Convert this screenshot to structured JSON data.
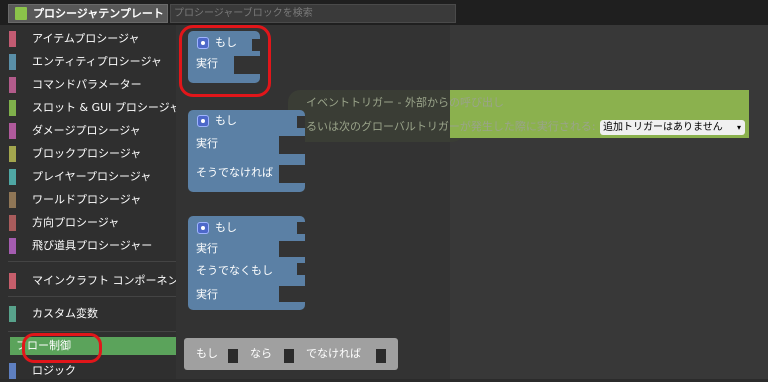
{
  "topbar": {
    "tab_label": "プロシージャテンプレート",
    "search_placeholder": "プロシージャーブロックを検索"
  },
  "sidebar": {
    "categories": [
      {
        "label": "アイテムプロシージャ",
        "color": "#c25b72"
      },
      {
        "label": "エンティティプロシージャ",
        "color": "#5a8fa8"
      },
      {
        "label": "コマンドパラメーター",
        "color": "#b25b8b"
      },
      {
        "label": "スロット & GUI プロシージャ",
        "color": "#7fb04b"
      },
      {
        "label": "ダメージプロシージャ",
        "color": "#b05a9c"
      },
      {
        "label": "ブロックプロシージャ",
        "color": "#a3a64e"
      },
      {
        "label": "プレイヤープロシージャ",
        "color": "#4fa7a4"
      },
      {
        "label": "ワールドプロシージャ",
        "color": "#8f7656"
      },
      {
        "label": "方向プロシージャ",
        "color": "#a95c5c"
      },
      {
        "label": "飛び道具プロシージャー",
        "color": "#a45cb0"
      },
      {
        "label": "マインクラフト コンポーネント",
        "color": "#c65e6b"
      },
      {
        "label": "カスタム変数",
        "color": "#58a28b"
      },
      {
        "label": "フロー制御",
        "color": "#5ba35b"
      },
      {
        "label": "ロジック",
        "color": "#5e7fc0"
      }
    ]
  },
  "blocks": {
    "if1": {
      "if_label": "もし",
      "do_label": "実行"
    },
    "if2": {
      "if_label": "もし",
      "do_label": "実行",
      "else_label": "そうでなければ"
    },
    "if3": {
      "if_label": "もし",
      "do_label": "実行",
      "elseif_label": "そうでなくもし",
      "do2_label": "実行"
    },
    "ternary": {
      "if_label": "もし",
      "then_label": "なら",
      "else_label": "でなければ"
    }
  },
  "event": {
    "title": "イベントトリガー - 外部からの呼び出し",
    "subtitle": "るいは次のグローバルトリガーが発生した際に実行される:",
    "dropdown_value": "追加トリガーはありません"
  },
  "colors": {
    "block_blue": "#5b80a5",
    "highlight_red": "#e1161a",
    "event_green": "#8bb14e",
    "selected_green": "#5ba35b"
  }
}
